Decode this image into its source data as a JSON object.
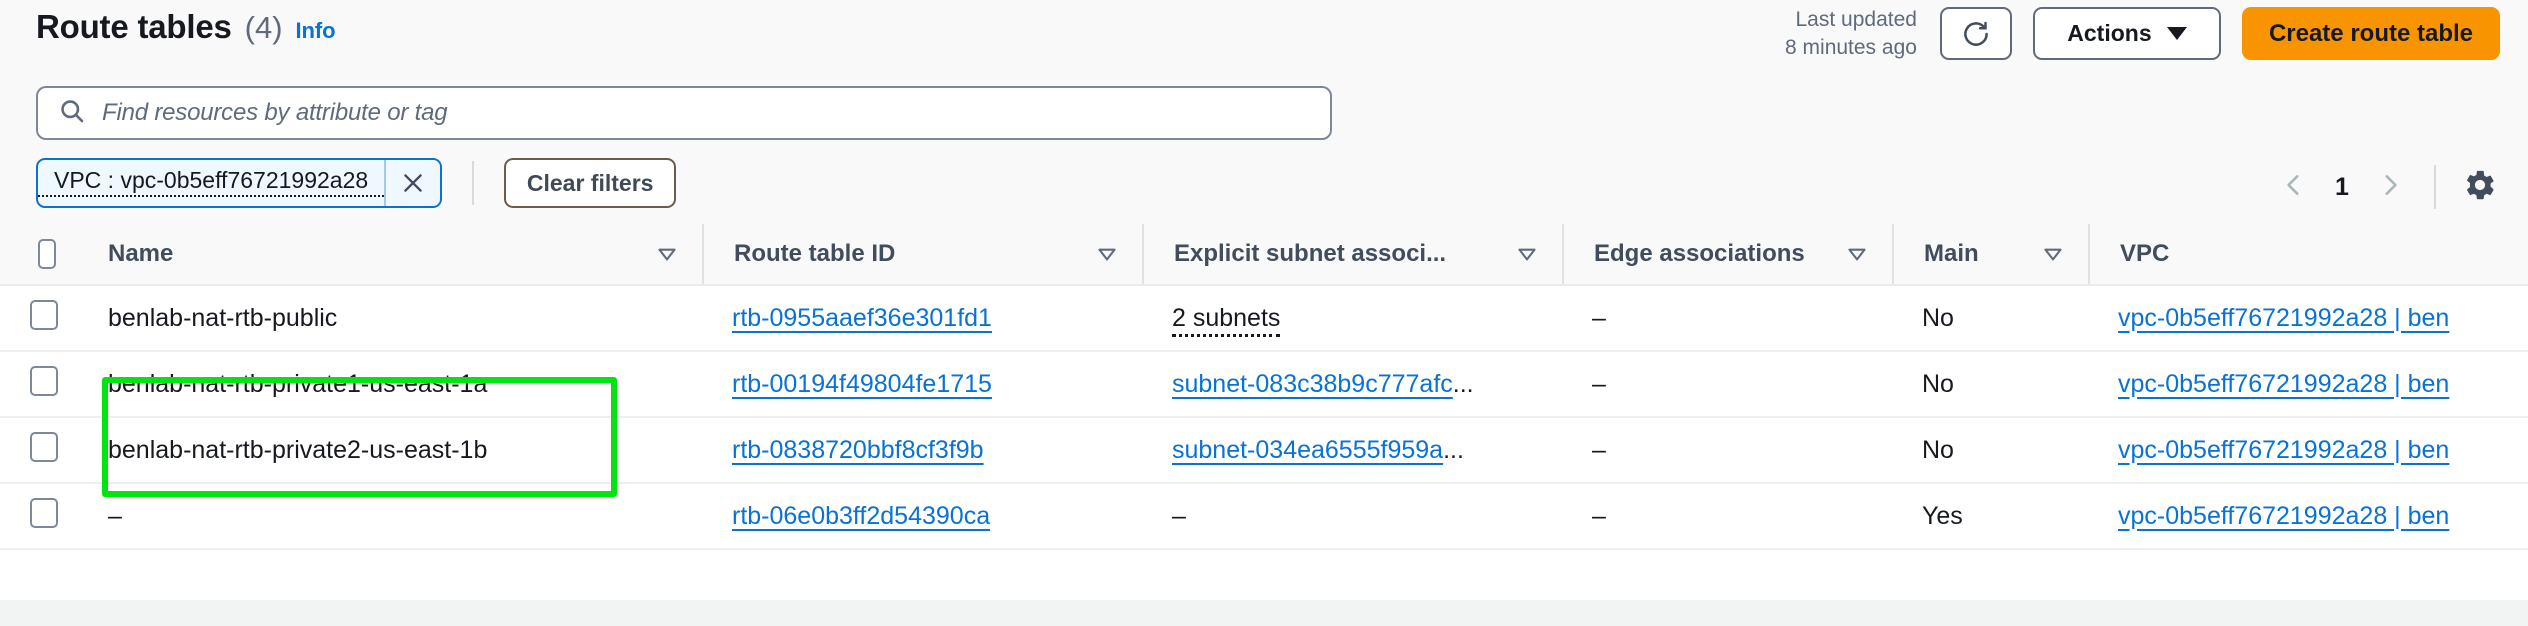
{
  "header": {
    "title": "Route tables",
    "count": "(4)",
    "info_label": "Info",
    "last_updated_line1": "Last updated",
    "last_updated_line2": "8 minutes ago",
    "refresh_icon": "refresh-icon",
    "actions_label": "Actions",
    "create_label": "Create route table",
    "accent_orange": "#f79400",
    "link_blue": "#0972d3"
  },
  "search": {
    "placeholder": "Find resources by attribute or tag",
    "value": "",
    "icon": "search-icon"
  },
  "filters": {
    "token_label": "VPC : vpc-0b5eff76721992a28",
    "token_remove_icon": "close-icon",
    "clear_label": "Clear filters"
  },
  "pagination": {
    "prev_icon": "chevron-left-icon",
    "page": "1",
    "next_icon": "chevron-right-icon",
    "settings_icon": "gear-icon"
  },
  "table": {
    "columns": [
      {
        "label": "Name",
        "sortable": true
      },
      {
        "label": "Route table ID",
        "sortable": true
      },
      {
        "label": "Explicit subnet associ...",
        "sortable": true
      },
      {
        "label": "Edge associations",
        "sortable": true
      },
      {
        "label": "Main",
        "sortable": true
      },
      {
        "label": "VPC",
        "sortable": false
      }
    ],
    "rows": [
      {
        "name": "benlab-nat-rtb-public",
        "route_table_id": "rtb-0955aaef36e301fd1",
        "explicit_subnet": "2 subnets",
        "explicit_subnet_style": "dotted",
        "edge_associations": "–",
        "main": "No",
        "vpc": "vpc-0b5eff76721992a28 | ben"
      },
      {
        "name": "benlab-nat-rtb-private1-us-east-1a",
        "route_table_id": "rtb-00194f49804fe1715",
        "explicit_subnet": "subnet-083c38b9c777afc",
        "explicit_subnet_style": "link-truncated",
        "edge_associations": "–",
        "main": "No",
        "vpc": "vpc-0b5eff76721992a28 | ben"
      },
      {
        "name": "benlab-nat-rtb-private2-us-east-1b",
        "route_table_id": "rtb-0838720bbf8cf3f9b",
        "explicit_subnet": "subnet-034ea6555f959a",
        "explicit_subnet_style": "link-truncated",
        "edge_associations": "–",
        "main": "No",
        "vpc": "vpc-0b5eff76721992a28 | ben"
      },
      {
        "name": "–",
        "route_table_id": "rtb-06e0b3ff2d54390ca",
        "explicit_subnet": "–",
        "explicit_subnet_style": "plain",
        "edge_associations": "–",
        "main": "Yes",
        "vpc": "vpc-0b5eff76721992a28 | ben"
      }
    ],
    "truncation_suffix": "..."
  },
  "annotation": {
    "color": "#00e510",
    "label": "highlight-private-route-table-names"
  }
}
